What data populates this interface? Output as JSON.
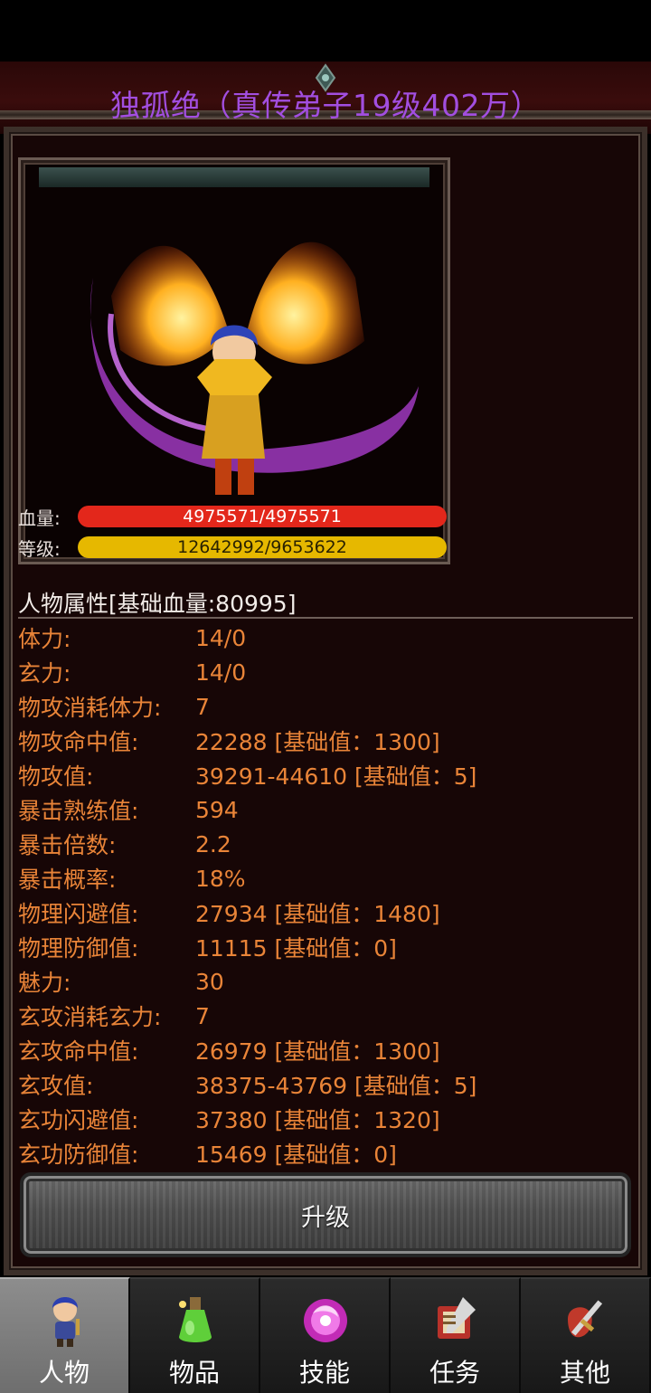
{
  "header": {
    "title": "独孤绝（真传弟子19级402万）"
  },
  "character": {
    "hp_label": "血量:",
    "hp_value": "4975571/4975571",
    "level_label": "等级:",
    "level_value": "12642992/9653622"
  },
  "attributes": {
    "heading": "人物属性[基础血量:80995]",
    "rows": [
      {
        "key": "体力:",
        "value": "14/0"
      },
      {
        "key": "玄力:",
        "value": "14/0"
      },
      {
        "key": "物攻消耗体力:",
        "value": "7"
      },
      {
        "key": "物攻命中值:",
        "value": "22288 [基础值：1300]"
      },
      {
        "key": "物攻值:",
        "value": "39291-44610 [基础值：5]"
      },
      {
        "key": "暴击熟练值:",
        "value": "594"
      },
      {
        "key": "暴击倍数:",
        "value": "2.2"
      },
      {
        "key": "暴击概率:",
        "value": "18%"
      },
      {
        "key": "物理闪避值:",
        "value": "27934 [基础值：1480]"
      },
      {
        "key": "物理防御值:",
        "value": "11115 [基础值：0]"
      },
      {
        "key": "魅力:",
        "value": "30"
      },
      {
        "key": "玄攻消耗玄力:",
        "value": "7"
      },
      {
        "key": "玄攻命中值:",
        "value": "26979 [基础值：1300]"
      },
      {
        "key": "玄攻值:",
        "value": "38375-43769 [基础值：5]"
      },
      {
        "key": "玄功闪避值:",
        "value": "37380 [基础值：1320]"
      },
      {
        "key": "玄功防御值:",
        "value": "15469 [基础值：0]"
      }
    ]
  },
  "actions": {
    "upgrade_label": "升级"
  },
  "tabs": [
    {
      "label": "人物",
      "icon": "character-icon",
      "active": true
    },
    {
      "label": "物品",
      "icon": "potion-icon",
      "active": false
    },
    {
      "label": "技能",
      "icon": "skill-orb-icon",
      "active": false
    },
    {
      "label": "任务",
      "icon": "quest-icon",
      "active": false
    },
    {
      "label": "其他",
      "icon": "sword-shield-icon",
      "active": false
    }
  ],
  "colors": {
    "title": "#a24ee0",
    "attribute_text": "#e98438",
    "hp_bar": "#e3271b",
    "level_bar": "#e6b800"
  }
}
